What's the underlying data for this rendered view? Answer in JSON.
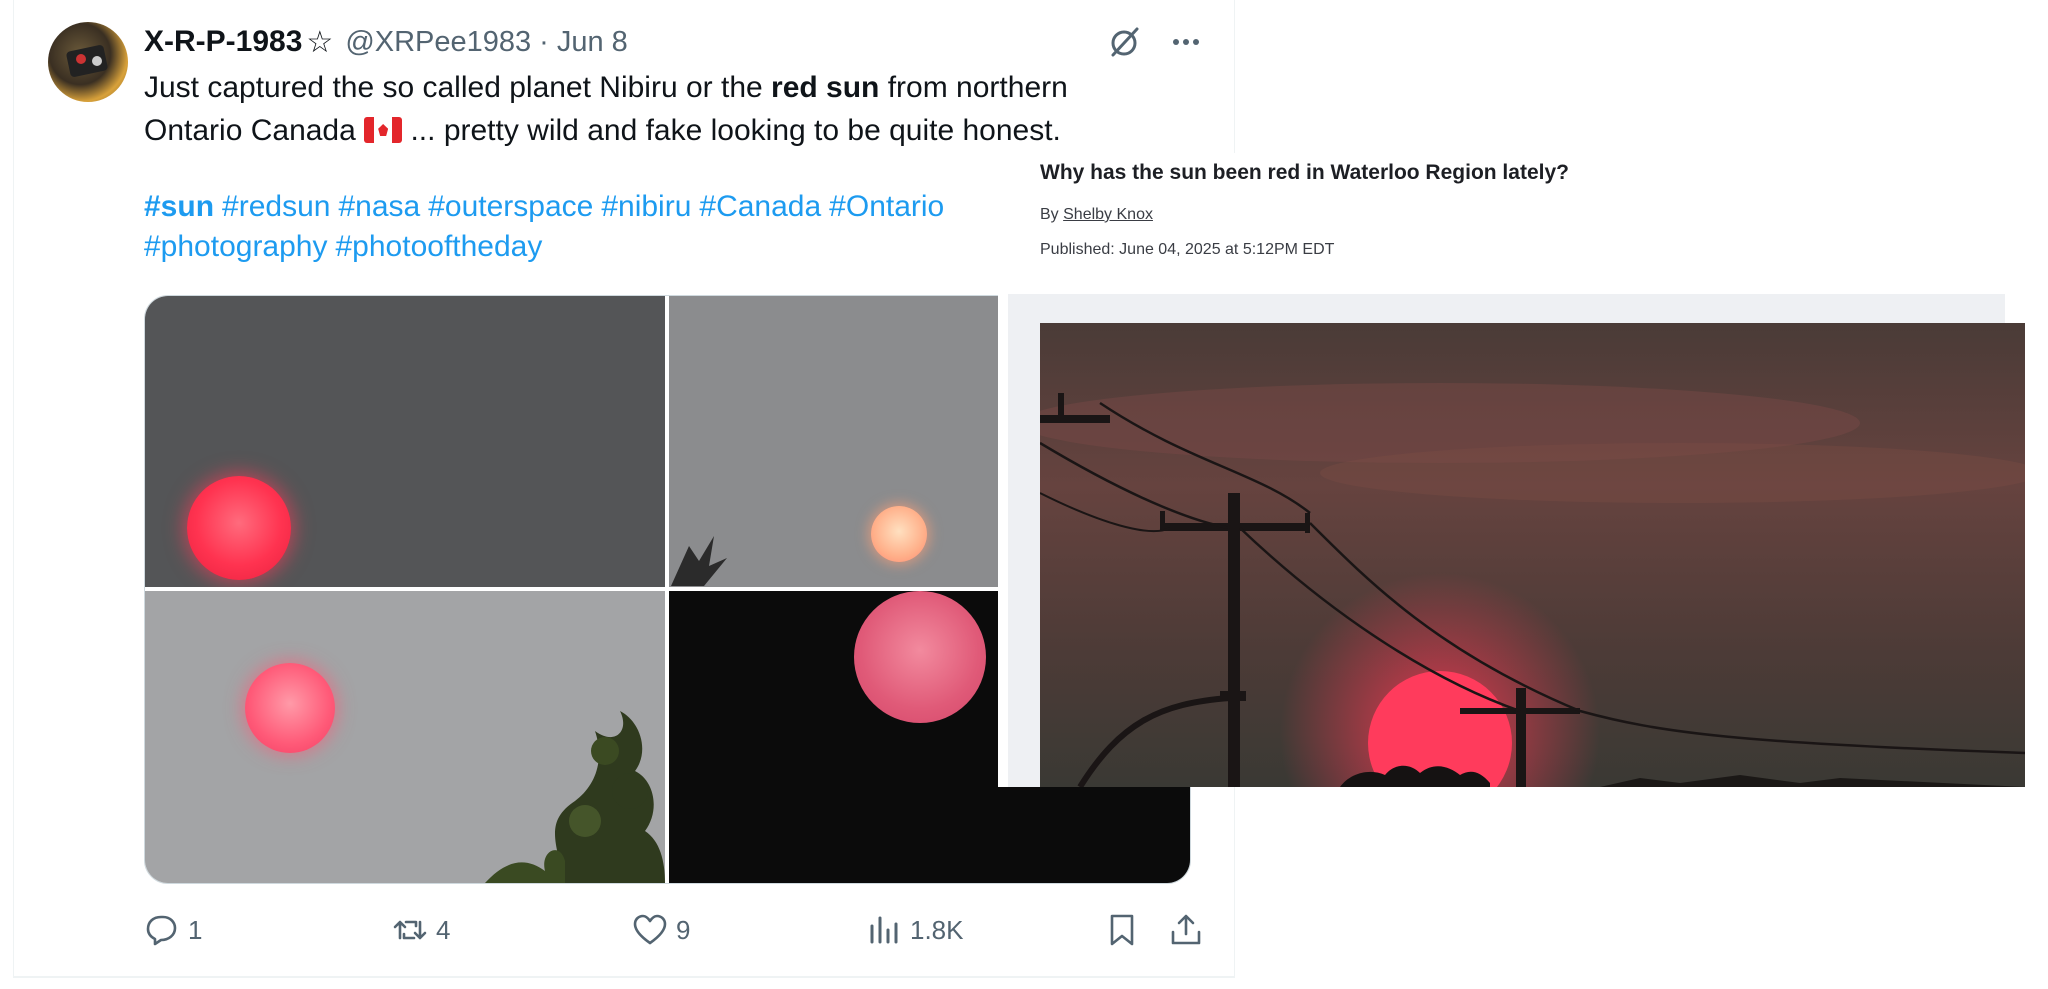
{
  "tweet": {
    "display_name": "X-R-P-1983",
    "name_symbol": "☆",
    "handle": "@XRPee1983",
    "separator": "·",
    "date": "Jun 8",
    "text_part1": "Just captured the so called planet Nibiru or the ",
    "text_bold": "red sun",
    "text_part2": " from northern",
    "text_line2_a": "Ontario Canada ",
    "text_line2_b": " ... pretty wild and fake looking to be quite honest.",
    "hashtags": [
      "#sun",
      "#redsun",
      "#nasa",
      "#outerspace",
      "#nibiru",
      "#Canada",
      "#Ontario"
    ],
    "hashtags_line2": [
      "#photography",
      "#photooftheday"
    ],
    "actions": {
      "replies": "1",
      "reposts": "4",
      "likes": "9",
      "views": "1.8K"
    }
  },
  "news": {
    "headline": "Why has the sun been red in Waterloo Region lately?",
    "by_label": "By ",
    "author": "Shelby Knox",
    "published": "Published: June 04, 2025 at 5:12PM EDT"
  },
  "colors": {
    "link_blue": "#1d9bf0",
    "muted_gray": "#536471",
    "sun_red": "#ff3b5c"
  },
  "icons": [
    "grok-icon",
    "more-icon",
    "reply-icon",
    "repost-icon",
    "like-icon",
    "views-icon",
    "bookmark-icon",
    "share-icon"
  ]
}
